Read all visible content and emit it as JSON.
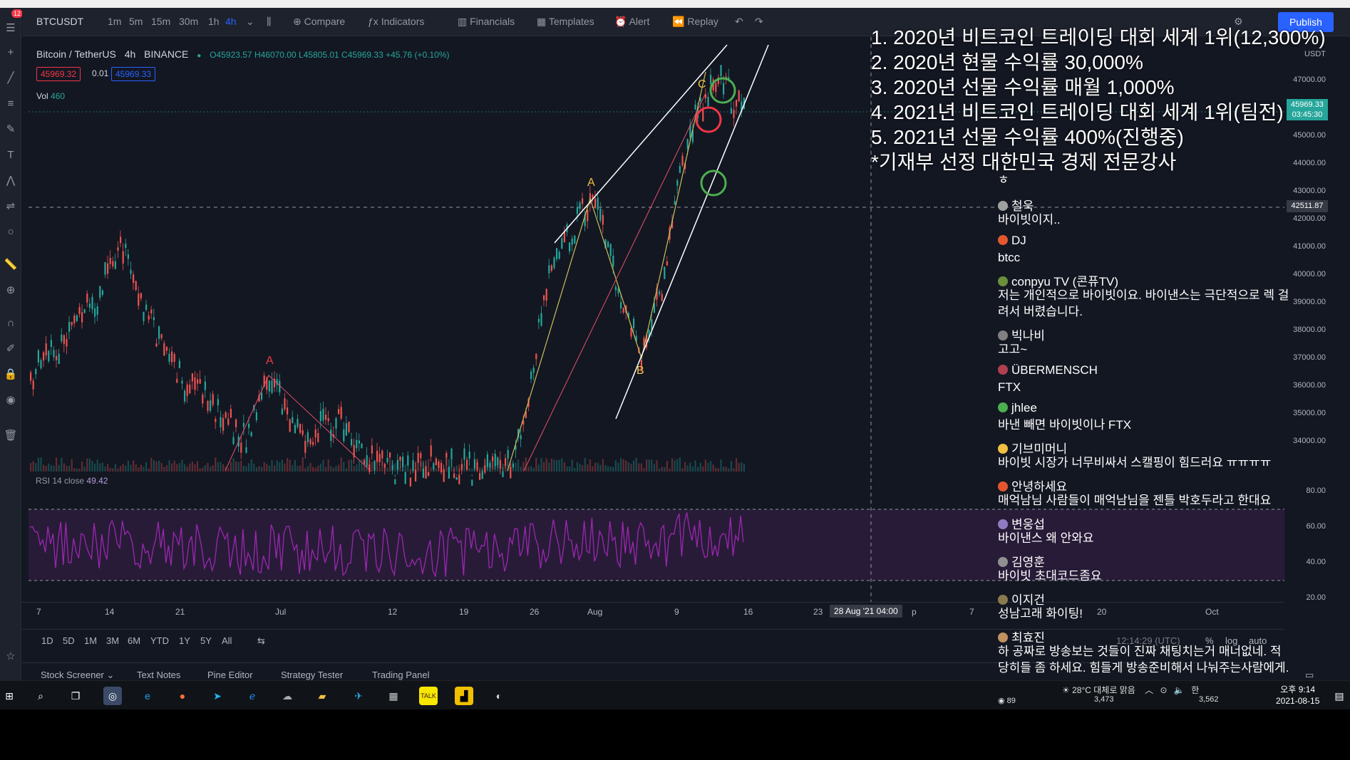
{
  "toolbar": {
    "symbol": "BTCUSDT",
    "timeframes": [
      "1m",
      "5m",
      "15m",
      "30m",
      "1h",
      "4h"
    ],
    "active_timeframe": "4h",
    "compare": "Compare",
    "indicators": "Indicators",
    "financials": "Financials",
    "templates": "Templates",
    "alert": "Alert",
    "replay": "Replay",
    "publish": "Publish",
    "menu_badge": "12"
  },
  "legend": {
    "title": "Bitcoin / TetherUS",
    "interval": "4h",
    "exchange": "BINANCE",
    "ohlc": "O45923.57 H46070.00 L45805.01 C45969.33 +45.76 (+0.10%)",
    "bid": "45969.32",
    "spread": "0.01",
    "ask": "45969.33",
    "vol_label": "Vol",
    "vol_value": "460"
  },
  "rsi": {
    "label": "RSI 14 close",
    "value": "49.42"
  },
  "price_axis": {
    "currency": "USDT",
    "labels": [
      "47000.00",
      "45000.00",
      "44000.00",
      "43000.00",
      "42000.00",
      "41000.00",
      "40000.00",
      "39000.00",
      "38000.00",
      "37000.00",
      "36000.00",
      "35000.00",
      "34000.00"
    ],
    "rsi_labels": [
      "80.00",
      "60.00",
      "40.00",
      "20.00"
    ],
    "last_price": "45969.33",
    "countdown": "03:45:30",
    "crosshair_price": "42511.87"
  },
  "time_axis": {
    "labels": [
      "7",
      "14",
      "21",
      "Jul",
      "12",
      "19",
      "26",
      "Aug",
      "9",
      "16",
      "23",
      "p",
      "7",
      "20",
      "Oct"
    ],
    "crosshair_time": "28 Aug '21   04:00"
  },
  "range_bar": {
    "ranges": [
      "1D",
      "5D",
      "1M",
      "3M",
      "6M",
      "YTD",
      "1Y",
      "5Y",
      "All"
    ],
    "utc_time": "12:14:29 (UTC)",
    "pct": "%",
    "log": "log",
    "auto": "auto"
  },
  "bottom_tabs": [
    "Stock Screener",
    "Text Notes",
    "Pine Editor",
    "Strategy Tester",
    "Trading Panel"
  ],
  "wave_labels": {
    "a_left": "A",
    "a_right": "A",
    "b": "B",
    "c": "C"
  },
  "achievements": [
    "1. 2020년 비트코인 트레이딩 대회 세계 1위(12,300%)",
    "2. 2020년 현물 수익률 30,000%",
    "3. 2020년 선물 수익률 매월 1,000%",
    "4. 2021년 비트코인 트레이딩 대회 세계 1위(팀전)",
    "5. 2021년 선물 수익률 400%(진행중)",
    "*기재부 선정 대한민국 경제 전문강사"
  ],
  "chat": {
    "partial_top": "ㅎ",
    "messages": [
      {
        "user": "철욱",
        "text": "바이빗이지..",
        "color": "#a0a0a0"
      },
      {
        "user": "DJ",
        "text": "btcc",
        "color": "#e4572e"
      },
      {
        "user": "conpyu TV (콘퓨TV)",
        "text": "저는 개인적으로 바이빗이요. 바이낸스는 극단적으로 렉 걸려서 버렸습니다.",
        "color": "#6b8f3a"
      },
      {
        "user": "빅나비",
        "text": "고고~",
        "color": "#808080"
      },
      {
        "user": "ÜBERMENSCH",
        "text": "FTX",
        "color": "#b04050"
      },
      {
        "user": "jhlee",
        "text": "바낸 빼면 바이빗이나 FTX",
        "color": "#4caf50"
      },
      {
        "user": "기브미머니",
        "text": "바이빗 시장가 너무비싸서 스캘핑이 힘드러요 ㅠㅠㅠㅠ",
        "color": "#f0c040"
      },
      {
        "user": "안녕하세요",
        "text": "매억남님 사람들이 매억남님을 젠틀 박호두라고 한대요",
        "color": "#e4572e"
      },
      {
        "user": "변웅섭",
        "text": "바이낸스 왜 안와요",
        "color": "#8e7cc3"
      },
      {
        "user": "김영훈",
        "text": "바이빗 초대코드좀요",
        "color": "#909090"
      },
      {
        "user": "이지건",
        "text": "성남고래 화이팅!",
        "color": "#8a7a50"
      },
      {
        "user": "최효진",
        "text": "하 공짜로 방송보는 것들이 진짜 채팅치는거 매너없네. 적당히들 좀 하세요. 힘들게 방송준비해서 나눠주는사람에게.",
        "color": "#c09060"
      }
    ]
  },
  "taskbar": {
    "weather": "28°C  대체로 맑음",
    "viewers": "89",
    "count_a": "3,473",
    "count_b": "3,562",
    "time": "오후 9:14",
    "date": "2021-08-15"
  }
}
